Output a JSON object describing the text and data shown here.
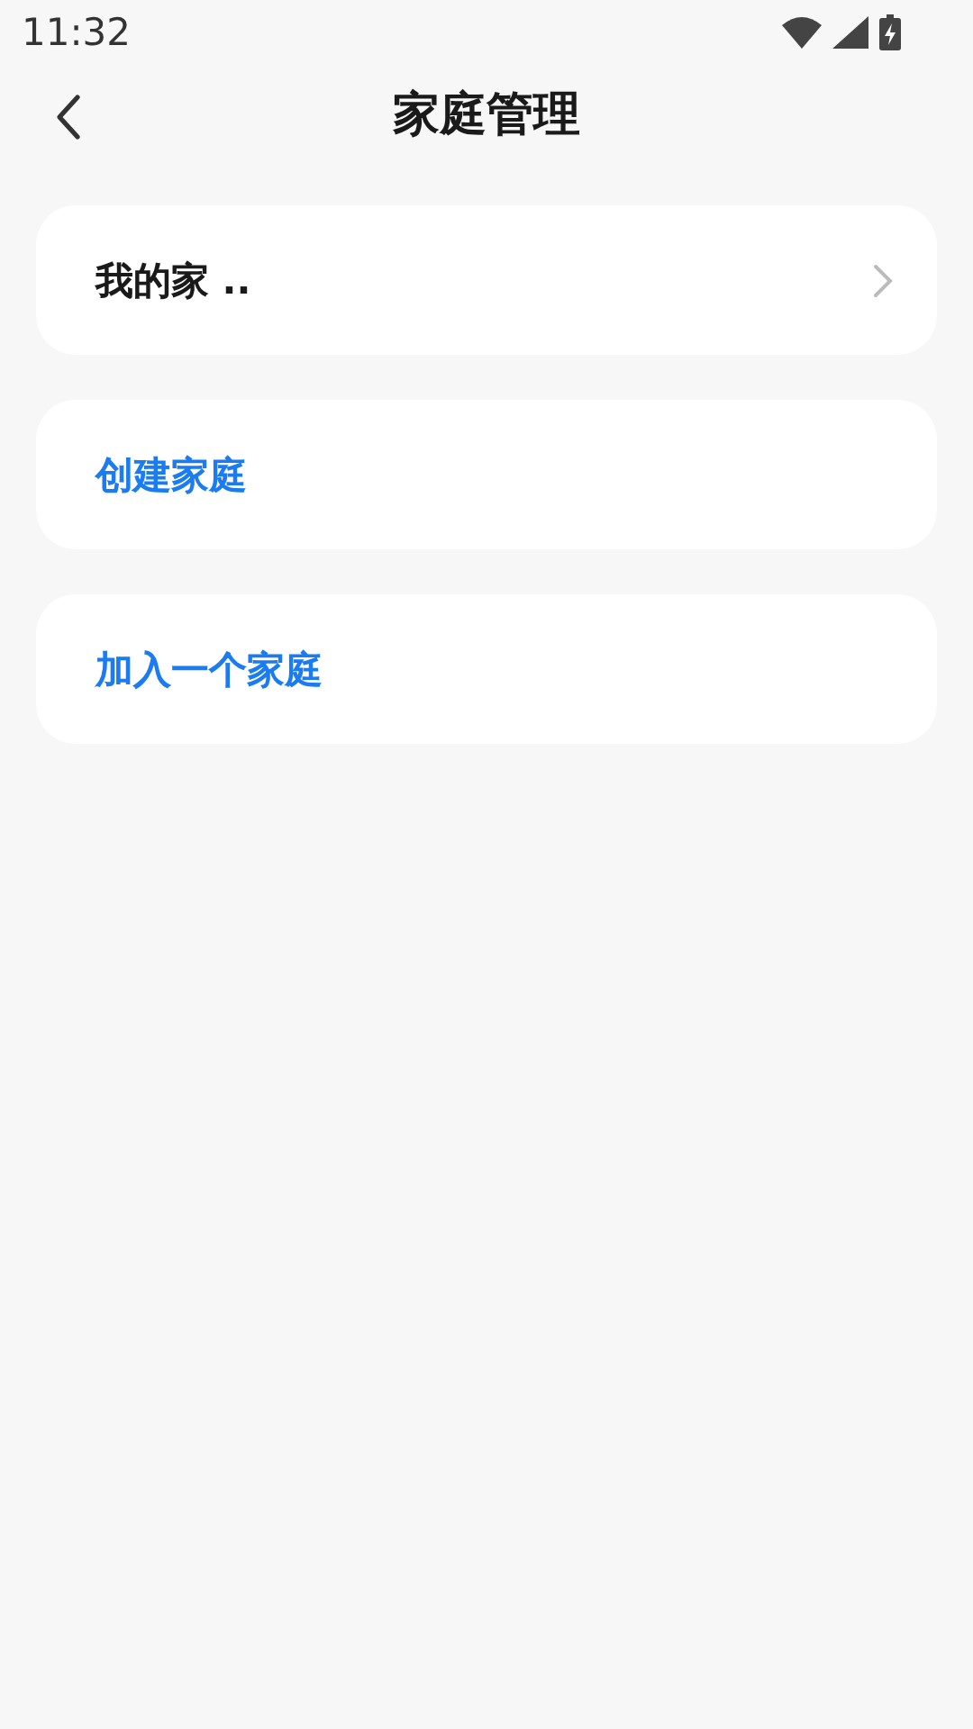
{
  "status_bar": {
    "time": "11:32"
  },
  "header": {
    "title": "家庭管理"
  },
  "cards": [
    {
      "kind": "nav",
      "label": "我的家 .."
    },
    {
      "kind": "action",
      "label": "创建家庭"
    },
    {
      "kind": "action",
      "label": "加入一个家庭"
    }
  ]
}
